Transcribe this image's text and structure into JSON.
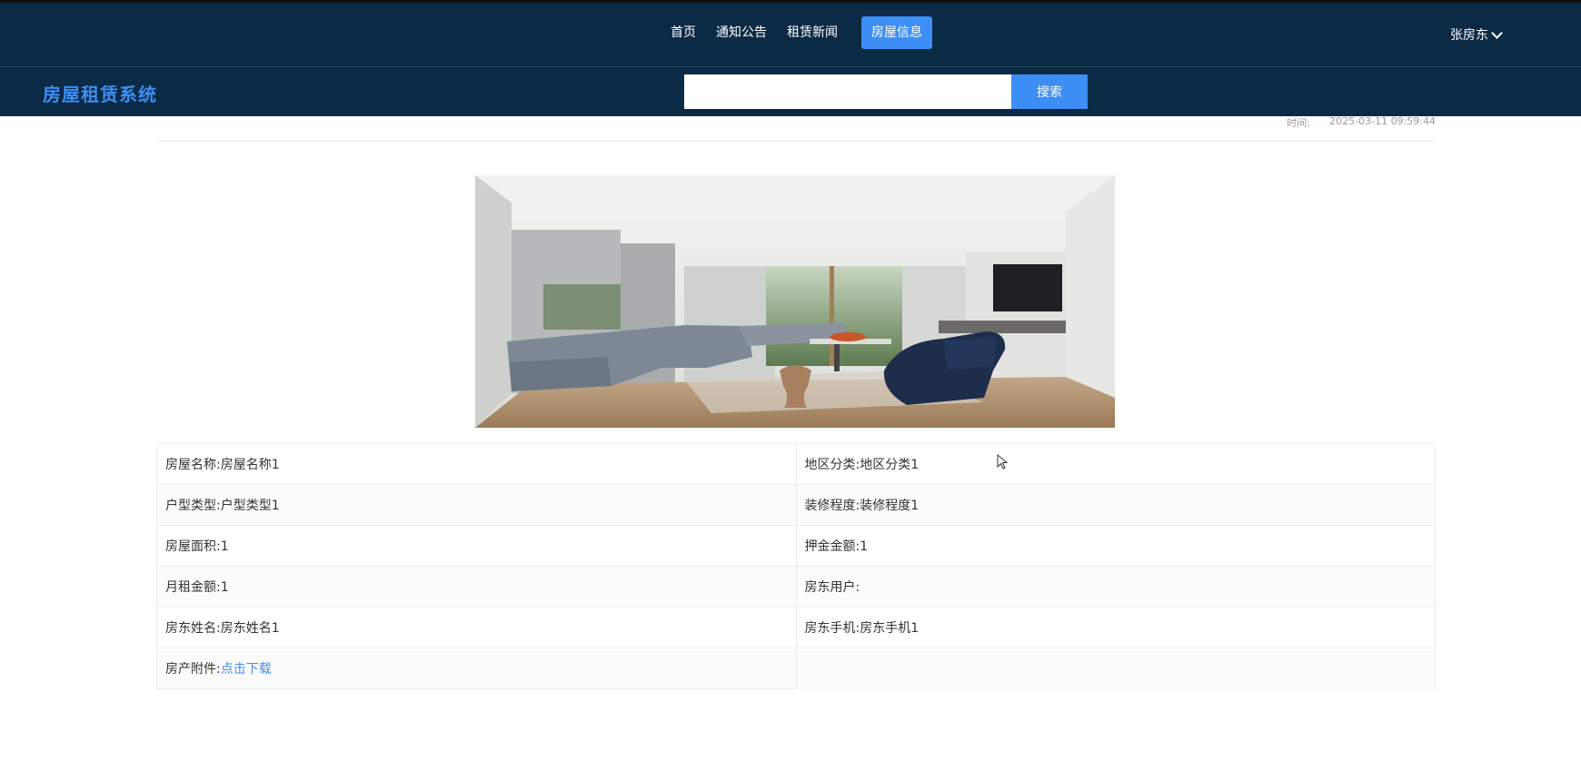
{
  "topbar": {
    "nav_items": [
      {
        "label": "首页",
        "active": false
      },
      {
        "label": "通知公告",
        "active": false
      },
      {
        "label": "租赁新闻",
        "active": false
      },
      {
        "label": "房屋信息",
        "active": true
      }
    ],
    "user_name": "张房东",
    "user_icon": "chevron-down-icon"
  },
  "header": {
    "brand": "房屋租赁系统",
    "search": {
      "value": "",
      "placeholder": "",
      "button_label": "搜索"
    }
  },
  "detail": {
    "time_label": "时间:",
    "time_value": "2025-03-11 09:59:44",
    "photo": {
      "subject": "living-room-interior"
    },
    "rows": [
      [
        {
          "label": "房屋名称:",
          "value": "房屋名称1"
        },
        {
          "label": "地区分类:",
          "value": "地区分类1"
        }
      ],
      [
        {
          "label": "户型类型:",
          "value": "户型类型1"
        },
        {
          "label": "装修程度:",
          "value": "装修程度1"
        }
      ],
      [
        {
          "label": "房屋面积:",
          "value": "1"
        },
        {
          "label": "押金金额:",
          "value": "1"
        }
      ],
      [
        {
          "label": "月租金额:",
          "value": "1"
        },
        {
          "label": "房东用户:",
          "value": ""
        }
      ],
      [
        {
          "label": "房东姓名:",
          "value": "房东姓名1"
        },
        {
          "label": "房东手机:",
          "value": "房东手机1"
        }
      ]
    ],
    "attachment": {
      "label": "房产附件:",
      "link_text": "点击下载"
    }
  },
  "colors": {
    "navbar": "#0b2a45",
    "accent": "#3d8ef5"
  }
}
